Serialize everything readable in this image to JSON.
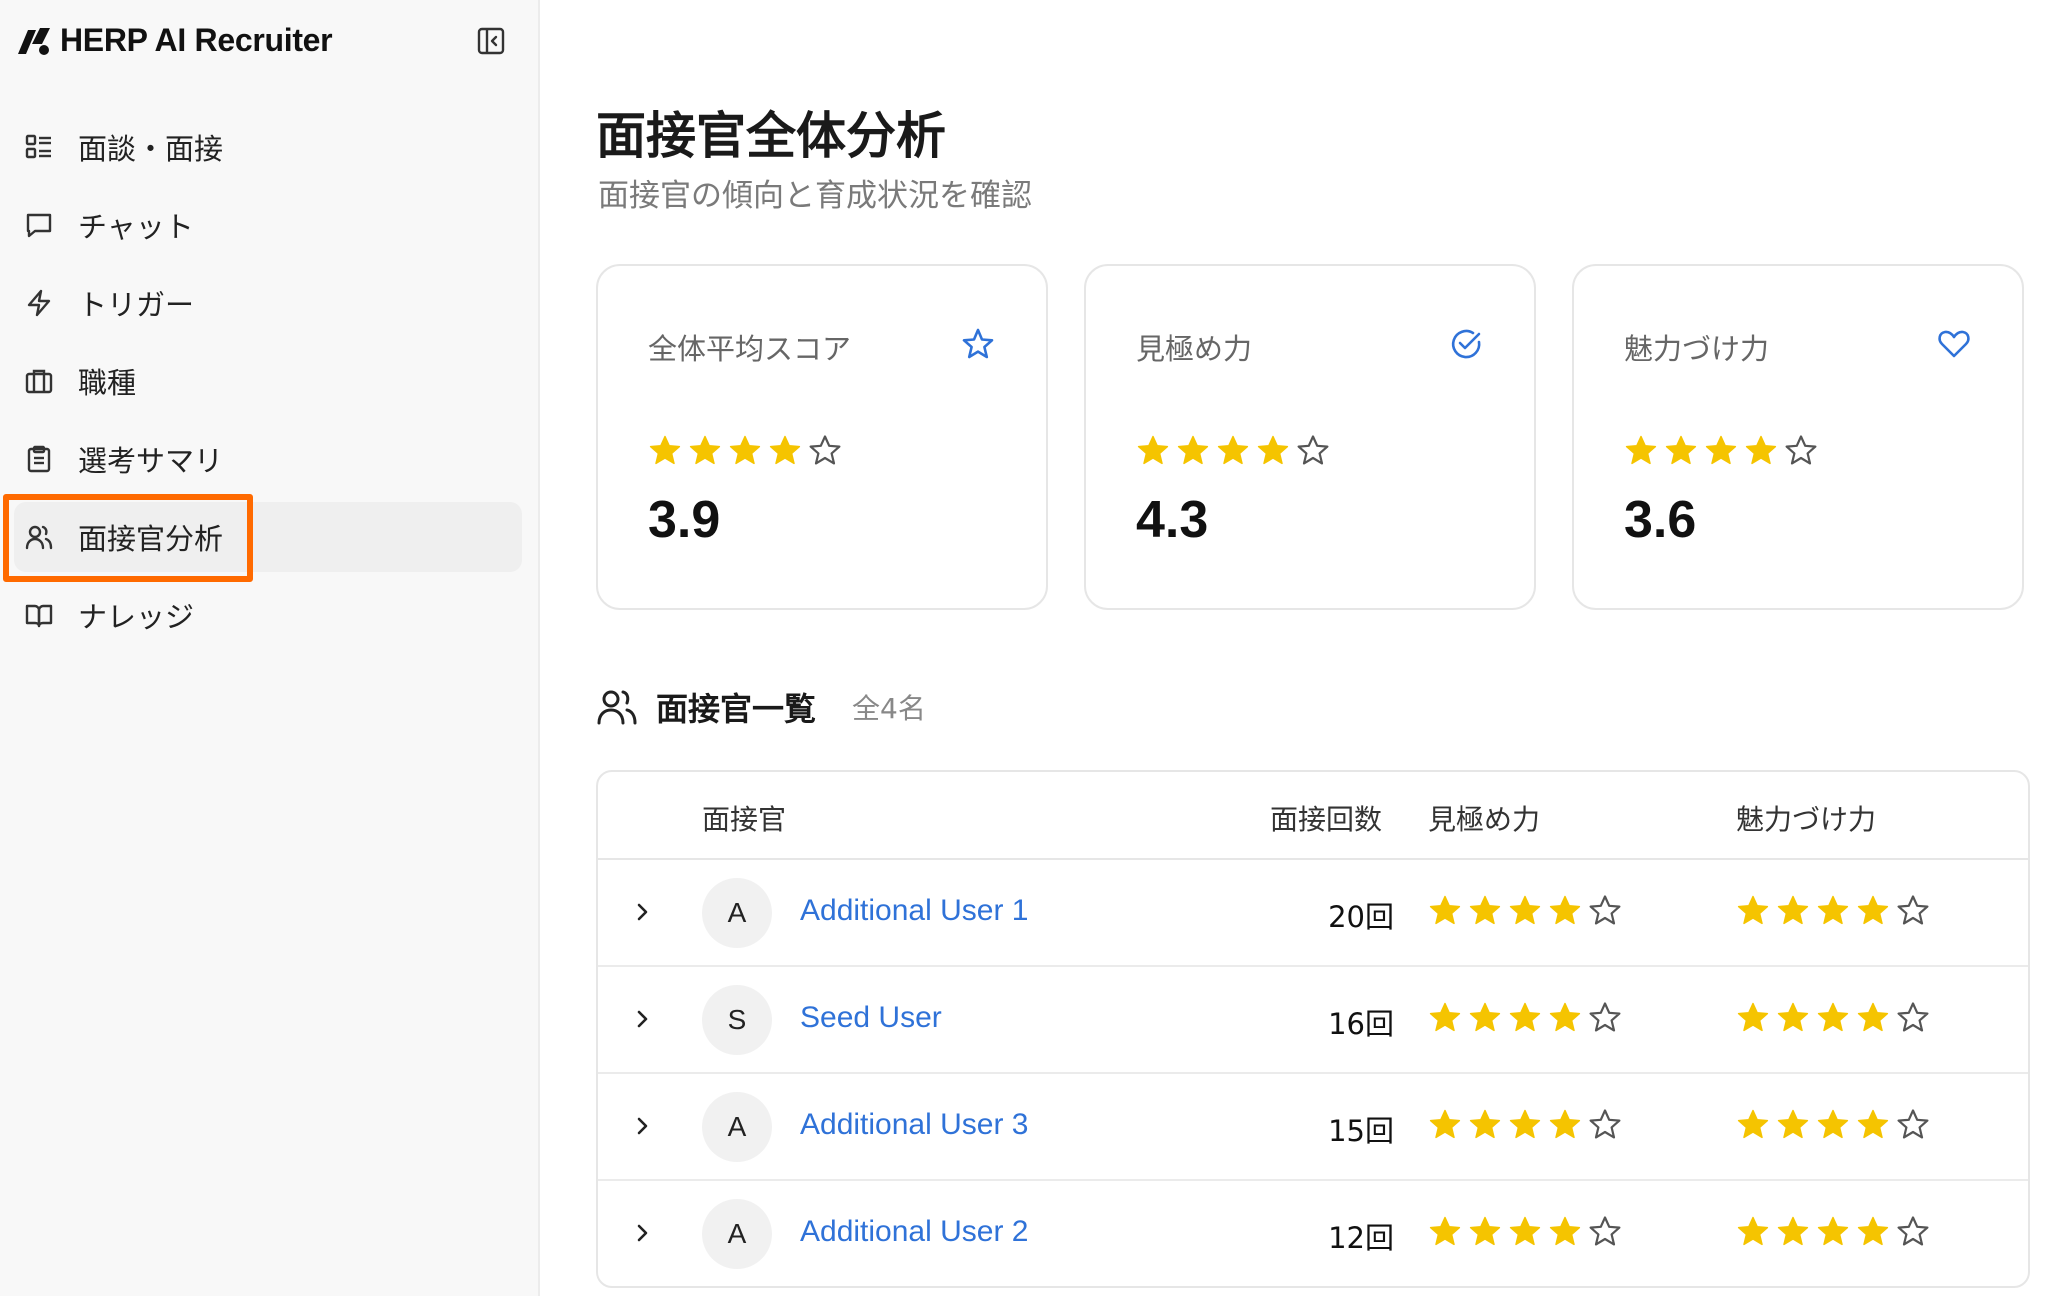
{
  "brand": {
    "name": "HERP AI Recruiter"
  },
  "sidebar": {
    "items": [
      {
        "label": "面談・面接",
        "icon": "list-grid-icon"
      },
      {
        "label": "チャット",
        "icon": "chat-bubble-icon"
      },
      {
        "label": "トリガー",
        "icon": "lightning-icon"
      },
      {
        "label": "職種",
        "icon": "briefcase-icon"
      },
      {
        "label": "選考サマリ",
        "icon": "clipboard-icon"
      },
      {
        "label": "面接官分析",
        "icon": "users-icon",
        "active": true
      },
      {
        "label": "ナレッジ",
        "icon": "book-icon"
      }
    ]
  },
  "page": {
    "title": "面接官全体分析",
    "subtitle": "面接官の傾向と育成状況を確認"
  },
  "cards": [
    {
      "label": "全体平均スコア",
      "icon": "star-outline-icon",
      "value": "3.9",
      "stars": 4
    },
    {
      "label": "見極め力",
      "icon": "check-circle-icon",
      "value": "4.3",
      "stars": 4
    },
    {
      "label": "魅力づけ力",
      "icon": "heart-icon",
      "value": "3.6",
      "stars": 4
    }
  ],
  "list": {
    "title": "面接官一覧",
    "count": "全4名",
    "columns": {
      "interviewer": "面接官",
      "count": "面接回数",
      "discernment": "見極め力",
      "attraction": "魅力づけ力"
    },
    "rows": [
      {
        "initial": "A",
        "name": "Additional User 1",
        "count": "20回",
        "discernment": 4,
        "attraction": 4
      },
      {
        "initial": "S",
        "name": "Seed User",
        "count": "16回",
        "discernment": 4,
        "attraction": 4
      },
      {
        "initial": "A",
        "name": "Additional User 3",
        "count": "15回",
        "discernment": 4,
        "attraction": 4
      },
      {
        "initial": "A",
        "name": "Additional User 2",
        "count": "12回",
        "discernment": 4,
        "attraction": 4
      }
    ]
  },
  "colors": {
    "accent": "#2f72d8",
    "star": "#f5c400",
    "highlight": "#ff6a00"
  }
}
